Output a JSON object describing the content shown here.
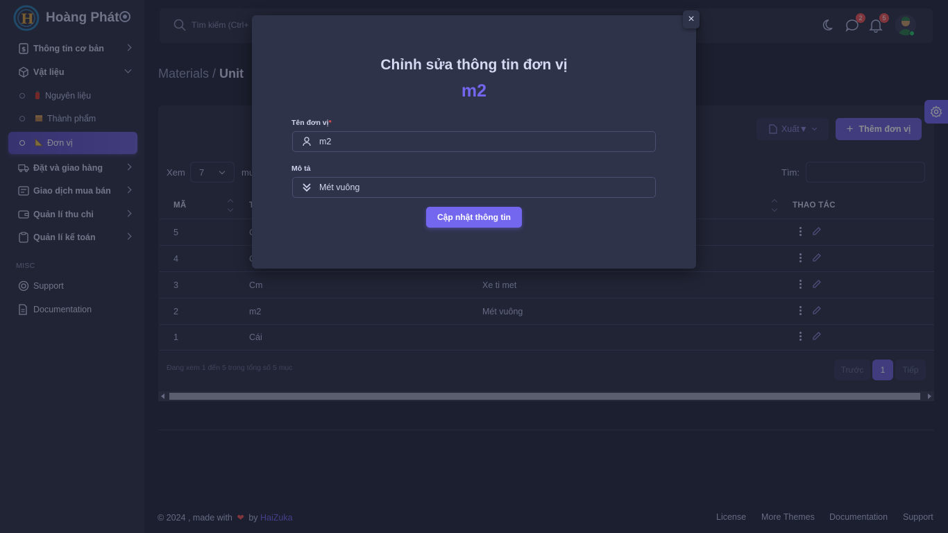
{
  "app": {
    "brand": "Hoàng Phát"
  },
  "sidebar": {
    "items": [
      {
        "label": "Thông tin cơ bản",
        "icon": "money-doc-icon"
      },
      {
        "label": "Vật liệu",
        "icon": "cube-icon"
      },
      {
        "label": "Nguyên liệu",
        "icon": "fire-extinguisher-icon"
      },
      {
        "label": "Thành phẩm",
        "icon": "box-icon"
      },
      {
        "label": "Đơn vị",
        "icon": "triangular-ruler-icon"
      },
      {
        "label": "Đặt và giao hàng",
        "icon": "truck-icon"
      },
      {
        "label": "Giao dịch mua bán",
        "icon": "receipt-icon"
      },
      {
        "label": "Quản lí thu chi",
        "icon": "wallet-icon"
      },
      {
        "label": "Quản lí kế toán",
        "icon": "clipboard-icon"
      }
    ],
    "misc_label": "MISC",
    "misc": [
      {
        "label": "Support",
        "icon": "lifebuoy-icon"
      },
      {
        "label": "Documentation",
        "icon": "document-icon"
      }
    ]
  },
  "navbar": {
    "search_placeholder": "Tìm kiếm (Ctrl+",
    "messages_badge": "2",
    "notifications_badge": "5"
  },
  "breadcrumb": {
    "parent": "Materials",
    "separator": " / ",
    "current": "Unit"
  },
  "toolbar": {
    "export_label": "Xuất▼",
    "add_label": "Thêm đơn vị"
  },
  "table_controls": {
    "show_label": "Xem",
    "show_value": "7",
    "show_suffix": "mu",
    "search_label": "Tìm:"
  },
  "table": {
    "headers": [
      "MÃ",
      "T",
      "THAO TÁC"
    ],
    "rows": [
      {
        "id": "5",
        "name": "C",
        "desc": ""
      },
      {
        "id": "4",
        "name": "C",
        "desc": ""
      },
      {
        "id": "3",
        "name": "Cm",
        "desc": "Xe ti met"
      },
      {
        "id": "2",
        "name": "m2",
        "desc": "Mét vuông"
      },
      {
        "id": "1",
        "name": "Cái",
        "desc": ""
      }
    ]
  },
  "pagination": {
    "info": "Đang xem 1 đến 5 trong tổng số 5 mục",
    "prev": "Trước",
    "page": "1",
    "next": "Tiếp"
  },
  "footer": {
    "copyright": "© 2024 , made with",
    "by": "by",
    "author": "HaiZuka",
    "links": [
      "License",
      "More Themes",
      "Documentation",
      "Support"
    ]
  },
  "modal": {
    "title": "Chỉnh sửa thông tin đơn vị",
    "subtitle": "m2",
    "name_label": "Tên đơn vị",
    "required_mark": "*",
    "name_value": "m2",
    "desc_label": "Mô tả",
    "desc_value": "Mét vuông",
    "submit_label": "Cập nhật thông tin",
    "close_label": "×"
  },
  "colors": {
    "accent": "#7367f0",
    "background": "#25293c",
    "surface": "#2f3349",
    "danger": "#ea5455",
    "online": "#28c76f"
  }
}
